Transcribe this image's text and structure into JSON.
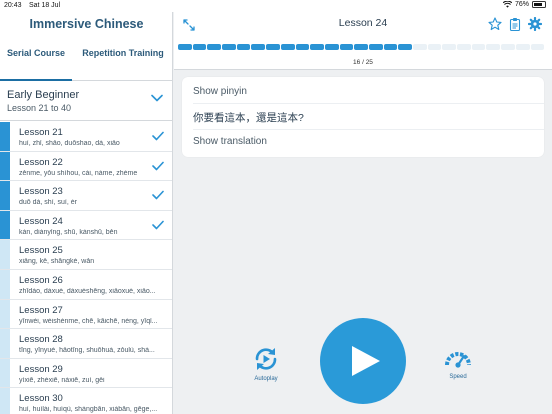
{
  "status_bar": {
    "time": "20:43",
    "date": "Sat 18 Jul",
    "battery": "76%",
    "battery_level": 0.76
  },
  "app": {
    "title": "Immersive Chinese"
  },
  "tabs": [
    {
      "label": "Serial Course",
      "active": true
    },
    {
      "label": "Repetition Training",
      "active": false
    }
  ],
  "level": {
    "name": "Early Beginner",
    "range": "Lesson 21 to 40"
  },
  "lessons": [
    {
      "title": "Lesson 21",
      "words": "huì, zhǐ, shǎo, duōshao, dà, xiǎo",
      "completed": true
    },
    {
      "title": "Lesson 22",
      "words": "zěnme, yǒu shíhou, cái, nàme, zhème",
      "completed": true
    },
    {
      "title": "Lesson 23",
      "words": "duō dà, shì, suì, ér",
      "completed": true
    },
    {
      "title": "Lesson 24",
      "words": "kàn, diànyǐng, shū, kànshū, běn",
      "completed": true
    },
    {
      "title": "Lesson 25",
      "words": "xiǎng, kě, shāngkè, wǎn",
      "completed": false
    },
    {
      "title": "Lesson 26",
      "words": "zhīdào, dàxué, dàxuéshēng, xiǎoxué, xiǎo...",
      "completed": false
    },
    {
      "title": "Lesson 27",
      "words": "yīnwèi, wèishénme, chē, kāichē, néng, yīqǐ...",
      "completed": false
    },
    {
      "title": "Lesson 28",
      "words": "tīng, yīnyuè, hǎotīng, shuōhuà, zǒulù, shà...",
      "completed": false
    },
    {
      "title": "Lesson 29",
      "words": "yìxiē, zhèxiē, nàxiē, zuì, gěi",
      "completed": false
    },
    {
      "title": "Lesson 30",
      "words": "huì, huílái, huíqù, shàngbān, xiàbān, gēge,...",
      "completed": false
    }
  ],
  "header": {
    "lesson_title": "Lesson 24"
  },
  "progress": {
    "current": 16,
    "total": 25,
    "counter_text": "16 / 25"
  },
  "card": {
    "show_pinyin": "Show pinyin",
    "sentence": "你要看這本，還是這本?",
    "show_translation": "Show translation"
  },
  "controls": {
    "autoplay_label": "Autoplay",
    "speed_label": "Speed"
  },
  "colors": {
    "accent": "#2a9ad8",
    "title": "#2c5a7a",
    "lesson_done_bar": "#2a93d4",
    "lesson_pending_bar": "#cfe7f5"
  },
  "icons": [
    "expand-icon",
    "star-icon",
    "clipboard-icon",
    "gear-icon",
    "chevron-down-icon",
    "check-icon",
    "autoplay-icon",
    "play-icon",
    "speedometer-icon"
  ]
}
